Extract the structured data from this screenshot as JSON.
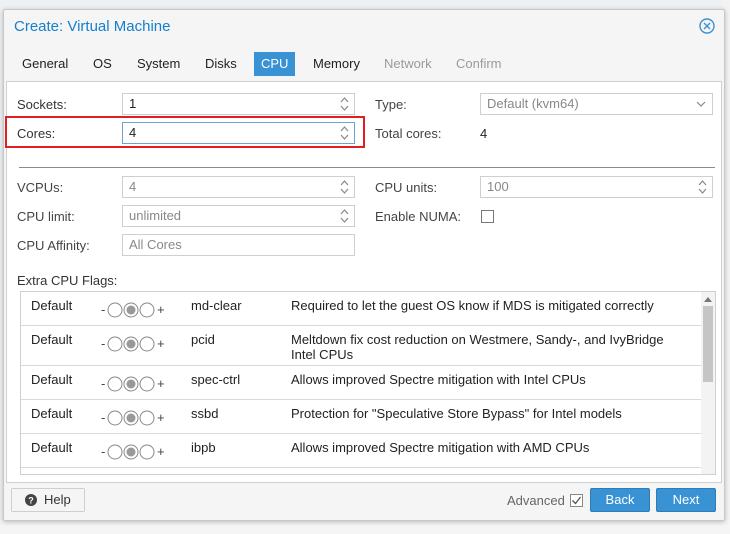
{
  "dialog": {
    "title": "Create: Virtual Machine"
  },
  "tabs": [
    {
      "label": "General"
    },
    {
      "label": "OS"
    },
    {
      "label": "System"
    },
    {
      "label": "Disks"
    },
    {
      "label": "CPU"
    },
    {
      "label": "Memory"
    },
    {
      "label": "Network"
    },
    {
      "label": "Confirm"
    }
  ],
  "cpu": {
    "sockets_label": "Sockets:",
    "sockets_value": "1",
    "type_label": "Type:",
    "type_value": "Default (kvm64)",
    "cores_label": "Cores:",
    "cores_value": "4",
    "total_cores_label": "Total cores:",
    "total_cores_value": "4",
    "vcpus_label": "VCPUs:",
    "vcpus_value": "4",
    "cpu_units_label": "CPU units:",
    "cpu_units_value": "100",
    "cpu_limit_label": "CPU limit:",
    "cpu_limit_value": "unlimited",
    "numa_label": "Enable NUMA:",
    "affinity_label": "CPU Affinity:",
    "affinity_placeholder": "All Cores",
    "extra_flags_label": "Extra CPU Flags:"
  },
  "flags": [
    {
      "state": "Default",
      "minus": "-",
      "plus": "+",
      "name": "md-clear",
      "desc": "Required to let the guest OS know if MDS is mitigated correctly"
    },
    {
      "state": "Default",
      "minus": "-",
      "plus": "+",
      "name": "pcid",
      "desc": "Meltdown fix cost reduction on Westmere, Sandy-, and IvyBridge Intel CPUs"
    },
    {
      "state": "Default",
      "minus": "-",
      "plus": "+",
      "name": "spec-ctrl",
      "desc": "Allows improved Spectre mitigation with Intel CPUs"
    },
    {
      "state": "Default",
      "minus": "-",
      "plus": "+",
      "name": "ssbd",
      "desc": "Protection for \"Speculative Store Bypass\" for Intel models"
    },
    {
      "state": "Default",
      "minus": "-",
      "plus": "+",
      "name": "ibpb",
      "desc": "Allows improved Spectre mitigation with AMD CPUs"
    }
  ],
  "footer": {
    "help_label": "Help",
    "advanced_label": "Advanced",
    "back_label": "Back",
    "next_label": "Next"
  }
}
